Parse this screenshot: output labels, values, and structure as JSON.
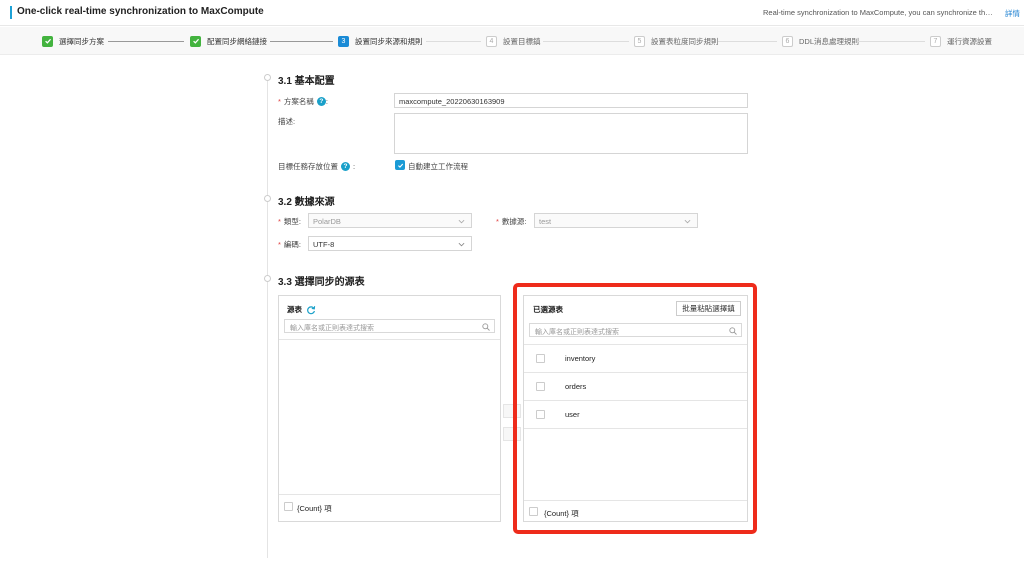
{
  "header": {
    "title": "One-click real-time synchronization to MaxCompute",
    "description": "Real-time synchronization to MaxCompute, you can synchronize the real-time data...",
    "detail_link": "詳情"
  },
  "steps": [
    {
      "label": "選擇同步方案",
      "status": "done",
      "number": "1"
    },
    {
      "label": "配置同步網絡鏈接",
      "status": "done",
      "number": "2"
    },
    {
      "label": "設置同步來源和規則",
      "status": "active",
      "number": "3"
    },
    {
      "label": "設置目標鎮",
      "status": "pending",
      "number": "4"
    },
    {
      "label": "設置表粒度同步規則",
      "status": "pending",
      "number": "5"
    },
    {
      "label": "DDL消息處理規則",
      "status": "pending",
      "number": "6"
    },
    {
      "label": "運行資源設置",
      "status": "pending",
      "number": "7"
    }
  ],
  "basic": {
    "title": "3.1 基本配置",
    "name_label": "方案名稱",
    "name_suffix": ":",
    "name_value": "maxcompute_20220630163909",
    "desc_label": "描述:",
    "desc_value": "",
    "location_label": "目標任務存放位置",
    "location_suffix": ":",
    "auto_create_label": "自動建立工作流程",
    "help_icon": "?"
  },
  "source": {
    "title": "3.2 數據來源",
    "type_label": "類型:",
    "type_value": "PolarDB",
    "datasource_label": "數據源:",
    "datasource_value": "test",
    "encoding_label": "編碼:",
    "encoding_value": "UTF-8",
    "required_mark": "*"
  },
  "tables": {
    "title": "3.3 選擇同步的源表",
    "source_panel": {
      "title": "源表",
      "search_placeholder": "輸入庫名或正則表達式搜索",
      "footer": "{Count} 項"
    },
    "selected_panel": {
      "title": "已選源表",
      "batch_button": "批量粘貼選擇鎮",
      "search_placeholder": "輸入庫名或正則表達式搜索",
      "items": [
        "inventory",
        "orders",
        "user"
      ],
      "footer": "{Count} 項"
    }
  },
  "colors": {
    "accent": "#1a8bd6",
    "done": "#43b33f",
    "highlight": "#ee2b1b",
    "required": "#e04040"
  }
}
